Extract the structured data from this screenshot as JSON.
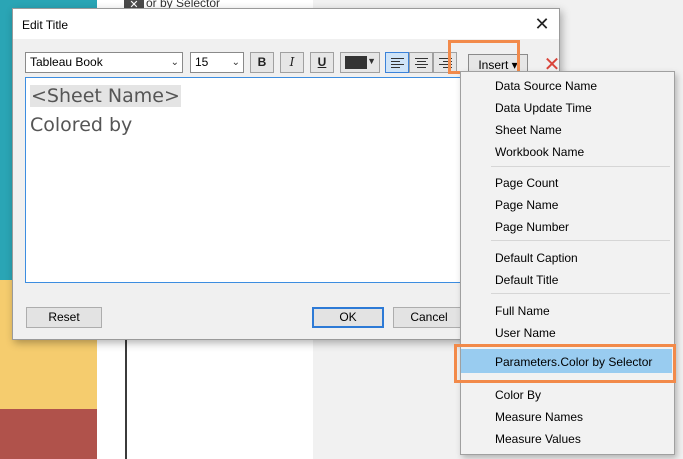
{
  "background": {
    "close_glyph": "✕",
    "header_text": "or by Selector"
  },
  "dialog": {
    "title": "Edit Title",
    "close_glyph": "✕",
    "toolbar": {
      "font_value": "Tableau Book",
      "size_value": "15",
      "bold_label": "B",
      "italic_label": "I",
      "underline_label": "U",
      "insert_label": "Insert ▾",
      "clear_glyph": "✕",
      "text_color": "#333333"
    },
    "editor": {
      "line1": "<Sheet Name>",
      "line2": "Colored by"
    },
    "buttons": {
      "reset": "Reset",
      "ok": "OK",
      "cancel": "Cancel"
    }
  },
  "menu": {
    "groups": [
      [
        "Data Source Name",
        "Data Update Time",
        "Sheet Name",
        "Workbook Name"
      ],
      [
        "Page Count",
        "Page Name",
        "Page Number"
      ],
      [
        "Default Caption",
        "Default Title"
      ],
      [
        "Full Name",
        "User Name"
      ],
      [
        "Parameters.Color by Selector"
      ],
      [
        "Color By",
        "Measure Names",
        "Measure Values"
      ]
    ],
    "selected": "Parameters.Color by Selector"
  },
  "colors": {
    "highlight_orange": "#f28a4a",
    "selection_blue": "#99ccf0",
    "teal": "#2aa5b5",
    "yellow": "#f5cc6e",
    "red": "#b0524b"
  }
}
